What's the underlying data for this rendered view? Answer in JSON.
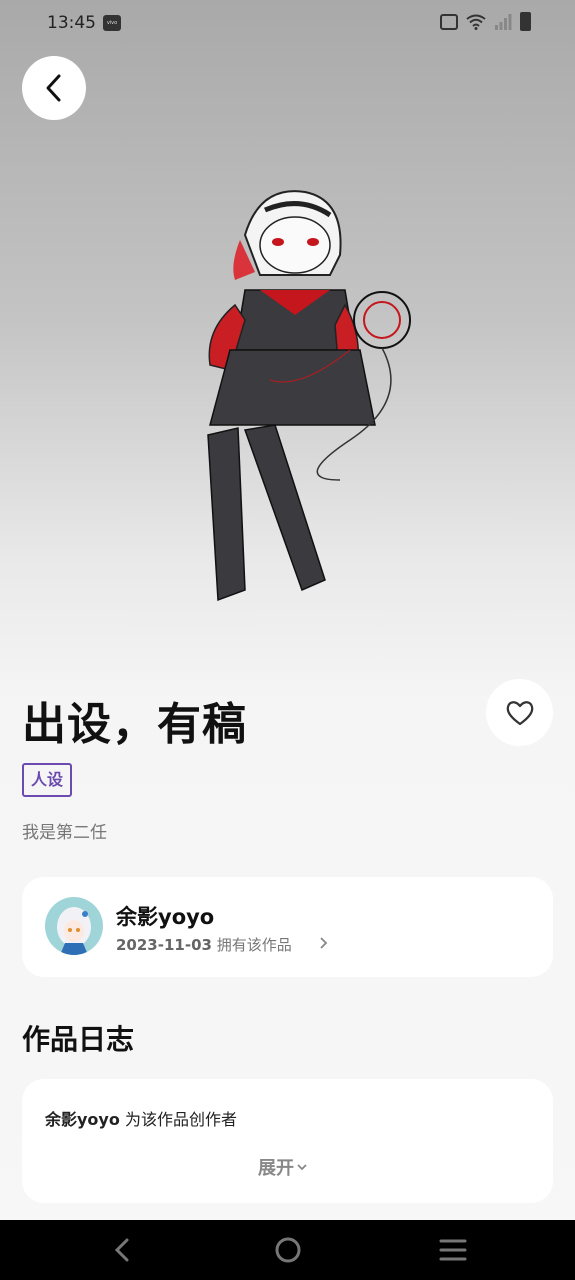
{
  "status_bar": {
    "time": "13:45",
    "brand_badge": "vivo"
  },
  "artwork": {
    "description_icon": "character-illustration"
  },
  "work": {
    "title": "出设，有稿",
    "tag": "人设",
    "description": "我是第二任"
  },
  "owner": {
    "name": "余影yoyo",
    "date": "2023-11-03",
    "ownership_text": "拥有该作品"
  },
  "log_section": {
    "title": "作品日志",
    "entry_name": "余影yoyo",
    "entry_text": "为该作品创作者",
    "expand_label": "展开"
  },
  "colors": {
    "accent": "#6b4bb0",
    "card_bg": "#ffffff"
  }
}
